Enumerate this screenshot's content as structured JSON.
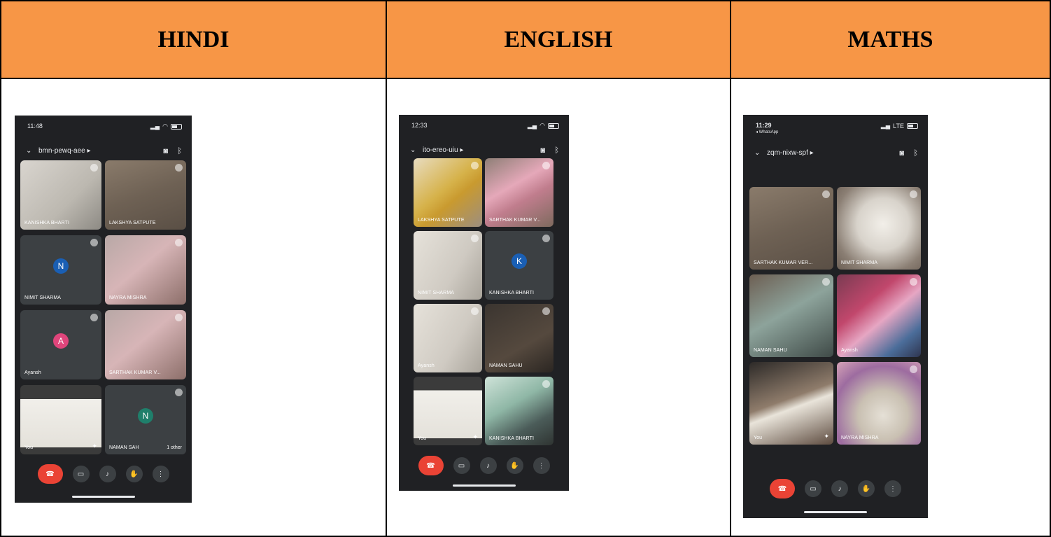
{
  "columns": [
    {
      "header": "HINDI",
      "phone": {
        "time": "11:48",
        "meeting_code": "bmn-pewq-aee ▸",
        "tiles": [
          {
            "name": "KANISHKA BHARTI",
            "style": "paper"
          },
          {
            "name": "LAKSHYA SATPUTE",
            "style": "wood"
          },
          {
            "name": "NIMIT SHARMA",
            "avatar": "N",
            "avatar_color": "#1a5fb4"
          },
          {
            "name": "NAYRA MISHRA",
            "style": "pinkish"
          },
          {
            "name": "Ayansh",
            "avatar": "A",
            "avatar_color": "#e0457b"
          },
          {
            "name": "SARTHAK KUMAR V...",
            "style": "pinkish"
          },
          {
            "name": "You",
            "style": "notebook",
            "sparkle": "✦"
          },
          {
            "name": "NAMAN SAH",
            "avatar": "N",
            "avatar_color": "#1f7f6b",
            "extra": "1 other"
          }
        ]
      }
    },
    {
      "header": "ENGLISH",
      "phone": {
        "time": "12:33",
        "meeting_code": "ito-ereo-uiu ▸",
        "tiles": [
          {
            "name": "LAKSHYA SATPUTE",
            "style": "yellow"
          },
          {
            "name": "SARTHAK KUMAR V...",
            "style": "pinkdress"
          },
          {
            "name": "NIMIT SHARMA",
            "style": "lightpaper"
          },
          {
            "name": "KANISHKA BHARTI",
            "avatar": "K",
            "avatar_color": "#1a5fb4"
          },
          {
            "name": "Ayansh",
            "style": "lightpaper"
          },
          {
            "name": "NAMAN SAHU",
            "style": "dark"
          },
          {
            "name": "You",
            "style": "notebook",
            "sparkle": "✦"
          },
          {
            "name": "KANISHKA BHARTI",
            "style": "greenroom"
          }
        ]
      }
    },
    {
      "header": "MATHS",
      "phone": {
        "time": "11:29",
        "sub": "◂ WhatsApp",
        "meeting_code": "zqm-nixw-spf ▸",
        "tiles": [
          {
            "name": "SARTHAK KUMAR VER...",
            "style": "wood"
          },
          {
            "name": "NIMIT SHARMA",
            "style": "plate"
          },
          {
            "name": "NAMAN SAHU",
            "style": "child"
          },
          {
            "name": "Ayansh",
            "style": "colorful"
          },
          {
            "name": "You",
            "style": "sticks",
            "sparkle": "✦"
          },
          {
            "name": "NAYRA MISHRA",
            "style": "bowl"
          }
        ]
      }
    }
  ],
  "controls": {
    "end_icon": "phone-hangup-icon",
    "camera_icon": "camera-icon",
    "mic_icon": "microphone-icon",
    "hand_icon": "raise-hand-icon",
    "more_icon": "more-vertical-icon"
  }
}
